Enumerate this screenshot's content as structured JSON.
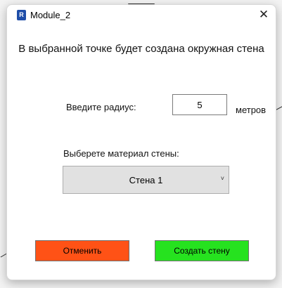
{
  "window": {
    "app_icon_letter": "R",
    "title": "Module_2",
    "close_icon": "close-icon",
    "close_glyph": "✕"
  },
  "form": {
    "heading": "В выбранной точке будет создана окружная стена",
    "radius_label": "Введите радиус:",
    "radius_value": "5",
    "radius_unit": "метров",
    "material_label": "Выберете материал стены:",
    "material_selected": "Стена 1",
    "chevron_icon": "chevron-down-icon",
    "chevron_glyph": "˅"
  },
  "buttons": {
    "cancel_label": "Отменить",
    "create_label": "Создать стену"
  },
  "colors": {
    "cancel_button": "#ff5216",
    "create_button": "#26e21f",
    "select_bg": "#e1e1e1"
  }
}
